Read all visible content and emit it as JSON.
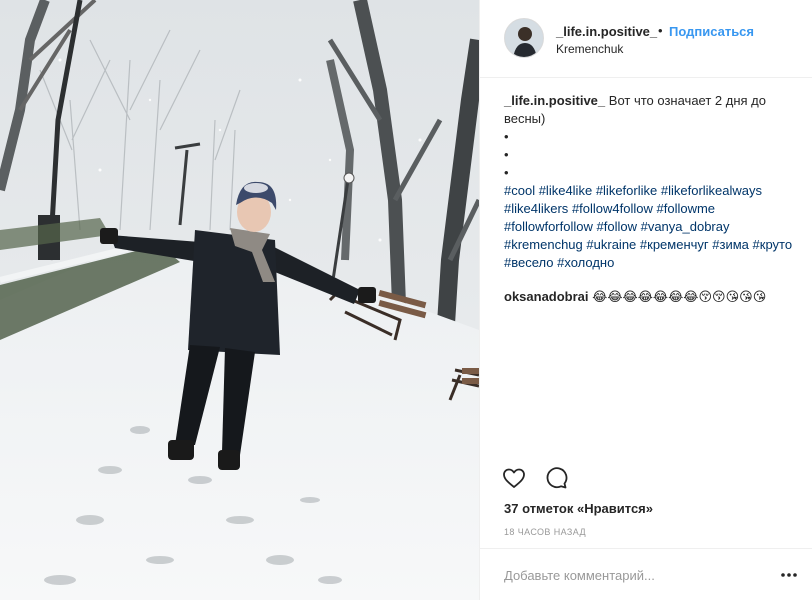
{
  "post": {
    "username": "_life.in.positive_",
    "separator": "•",
    "follow_label": "Подписаться",
    "location": "Kremenchuk",
    "caption": {
      "text": "Вот что означает 2 дня до весны)",
      "dots": [
        "•",
        "•",
        "•"
      ],
      "hashtags": [
        "#cool",
        "#like4like",
        "#likeforlike",
        "#likeforlikealways",
        "#like4likers",
        "#follow4follow",
        "#followme",
        "#followforfollow",
        "#follow",
        "#vanya_dobray",
        "#kremenchug",
        "#ukraine",
        "#кременчуг",
        "#зима",
        "#круто",
        "#весело",
        "#холодно"
      ]
    },
    "comments": [
      {
        "username": "oksanadobrai",
        "text": "😂😂😂😂😂😂😂😚😚😘😘😘"
      }
    ],
    "likes_text": "37 отметок «Нравится»",
    "time_text": "18 ЧАСОВ НАЗАД",
    "comment_placeholder": "Добавьте комментарий...",
    "icons": {
      "like": "heart-icon",
      "comment": "comment-icon",
      "more": "more-options-icon"
    },
    "colors": {
      "link": "#3897f0",
      "hashtag": "#003569",
      "muted": "#999999"
    }
  }
}
